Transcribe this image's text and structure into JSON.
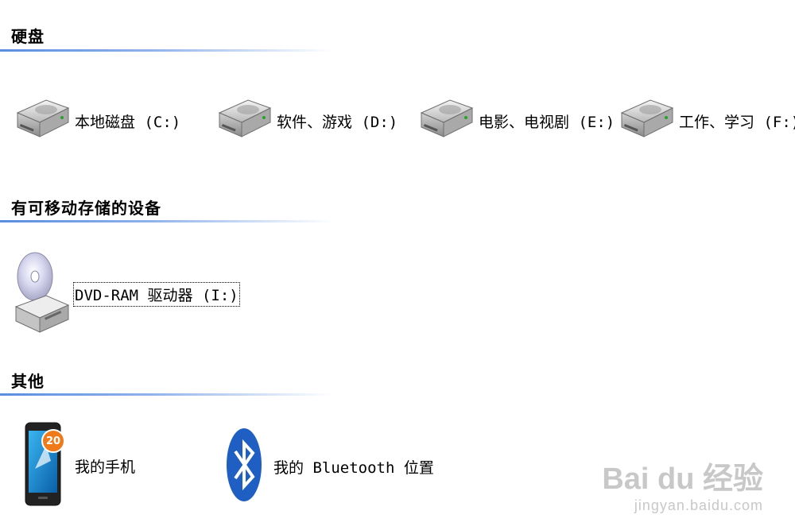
{
  "sections": {
    "hard_disks": {
      "title": "硬盘",
      "drives": [
        {
          "label": "本地磁盘 (C:)",
          "icon": "hard-drive-icon"
        },
        {
          "label": "软件、游戏 (D:)",
          "icon": "hard-drive-icon"
        },
        {
          "label": "电影、电视剧 (E:)",
          "icon": "hard-drive-icon"
        },
        {
          "label": "工作、学习 (F:)",
          "icon": "hard-drive-icon"
        }
      ]
    },
    "removable": {
      "title": "有可移动存储的设备",
      "drives": [
        {
          "label": "DVD-RAM 驱动器 (I:)",
          "icon": "dvd-drive-icon"
        }
      ]
    },
    "other": {
      "title": "其他",
      "items": [
        {
          "label": "我的手机",
          "icon": "phone-icon",
          "badge": "20"
        },
        {
          "label": "我的 Bluetooth 位置",
          "icon": "bluetooth-icon"
        }
      ]
    }
  },
  "watermark": {
    "main": "Bai du 经验",
    "sub": "jingyan.baidu.com"
  },
  "colors": {
    "section_rule": "#5a8de0",
    "bluetooth": "#1f5fc4",
    "badge": "#f07a1a"
  }
}
